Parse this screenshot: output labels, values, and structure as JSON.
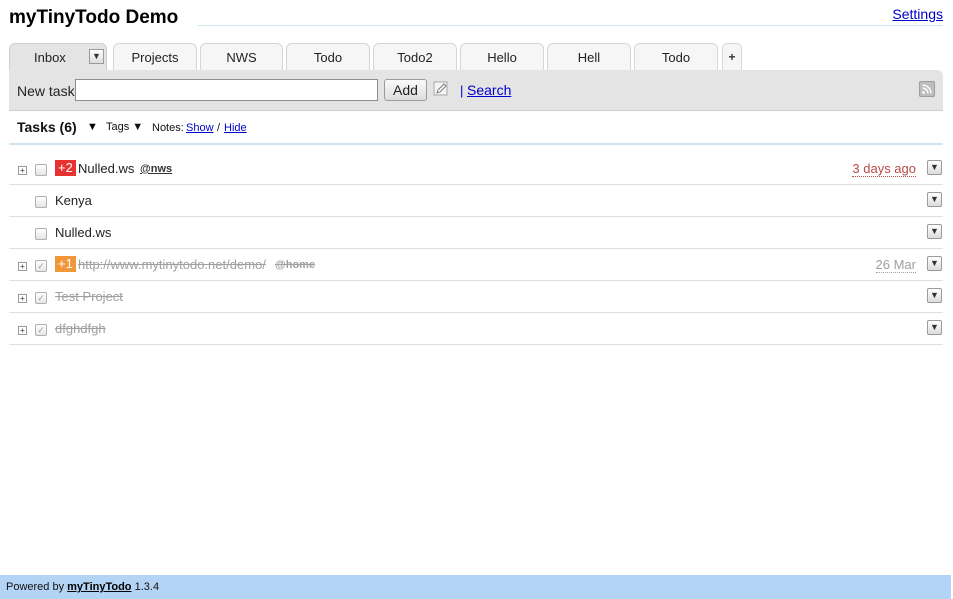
{
  "header": {
    "title": "myTinyTodo Demo",
    "settings_label": "Settings"
  },
  "tabs": {
    "items": [
      {
        "label": "Inbox",
        "active": true
      },
      {
        "label": "Projects"
      },
      {
        "label": "NWS"
      },
      {
        "label": "Todo"
      },
      {
        "label": "Todo2"
      },
      {
        "label": "Hello"
      },
      {
        "label": "Hell"
      },
      {
        "label": "Todo"
      }
    ],
    "menu_icon": "▼",
    "add_icon": "+"
  },
  "toolbar": {
    "newtask_label": "New task",
    "newtask_value": "",
    "add_label": "Add",
    "search_sep": "|",
    "search_label": "Search"
  },
  "tasks_bar": {
    "title": "Tasks (6)",
    "arrow": "▼",
    "tags_label": "Tags ▼",
    "notes_label": "Notes:",
    "show_label": "Show",
    "sep": "/",
    "hide_label": "Hide"
  },
  "tasks": [
    {
      "expand": "+",
      "prio": "+2",
      "prio_color": "#e83131",
      "text": "Nulled.ws",
      "tag": "@nws",
      "date": "3 days ago",
      "done": false
    },
    {
      "text": "Kenya",
      "done": false
    },
    {
      "text": "Nulled.ws",
      "done": false
    },
    {
      "expand": "+",
      "prio": "+1",
      "prio_color": "#f2963a",
      "text": "http://www.mytinytodo.net/demo/",
      "tag": "@home",
      "date": "26 Mar",
      "done": true
    },
    {
      "expand": "+",
      "text": "Test Project",
      "done": true
    },
    {
      "expand": "+",
      "text": "dfghdfgh",
      "done": true
    }
  ],
  "row_menu_icon": "▼",
  "check_mark": "✓",
  "footer": {
    "prefix": "Powered by",
    "link": "myTinyTodo",
    "version": "1.3.4"
  }
}
